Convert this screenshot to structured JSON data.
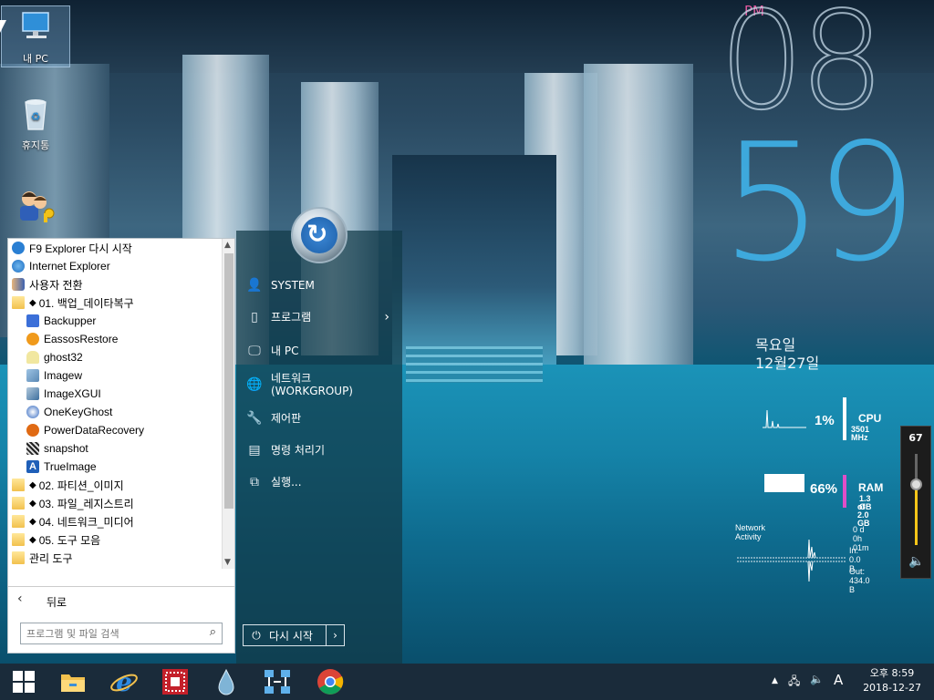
{
  "desktop": {
    "icons": [
      {
        "label": "내 PC",
        "icon": "monitor-icon"
      },
      {
        "label": "휴지통",
        "icon": "recycle-bin-icon"
      },
      {
        "label": "",
        "icon": "users-keys-icon"
      }
    ]
  },
  "clock": {
    "ampm": "PM",
    "hour": "08",
    "minute": "59",
    "weekday": "목요일",
    "date": "12월27일"
  },
  "monitor": {
    "cpu": {
      "label": "CPU",
      "percent": "1%",
      "detail": "3501 MHz",
      "level": 0.01
    },
    "ram": {
      "label": "RAM",
      "percent": "66%",
      "detail1": "1.3 GB",
      "detail2": "of 2.0 GB",
      "level": 0.66
    },
    "network": {
      "title": "Network Activity",
      "uptime": "0 d 0h 01m",
      "in": "In: 0.0 B",
      "out": "Out: 434.0 B"
    },
    "colors": {
      "cpu_bar": "#ffffff",
      "ram_bar": "#e04ec8"
    }
  },
  "volume": {
    "value": "67",
    "level": 0.67
  },
  "start_menu": {
    "programs": [
      {
        "label": "F9 Explorer 다시 시작",
        "icon": "refresh-icon",
        "type": "app",
        "indent": false
      },
      {
        "label": "Internet Explorer",
        "icon": "ie-icon",
        "type": "app",
        "indent": false
      },
      {
        "label": "사용자 전환",
        "icon": "users-icon",
        "type": "app",
        "indent": false
      },
      {
        "label": "01. 백업_데이타복구",
        "icon": "folder-icon",
        "type": "folder",
        "indent": false
      },
      {
        "label": "Backupper",
        "icon": "backupper-icon",
        "type": "app",
        "indent": true
      },
      {
        "label": "EassosRestore",
        "icon": "eassos-icon",
        "type": "app",
        "indent": true
      },
      {
        "label": "ghost32",
        "icon": "ghost-icon",
        "type": "app",
        "indent": true
      },
      {
        "label": "Imagew",
        "icon": "imagew-icon",
        "type": "app",
        "indent": true
      },
      {
        "label": "ImageXGUI",
        "icon": "imagex-icon",
        "type": "app",
        "indent": true
      },
      {
        "label": "OneKeyGhost",
        "icon": "onekey-icon",
        "type": "app",
        "indent": true
      },
      {
        "label": "PowerDataRecovery",
        "icon": "powerdata-icon",
        "type": "app",
        "indent": true
      },
      {
        "label": "snapshot",
        "icon": "snapshot-icon",
        "type": "app",
        "indent": true
      },
      {
        "label": "TrueImage",
        "icon": "trueimage-icon",
        "type": "app",
        "indent": true
      },
      {
        "label": "02. 파티션_이미지",
        "icon": "folder-icon",
        "type": "folder",
        "indent": false
      },
      {
        "label": "03. 파일_레지스트리",
        "icon": "folder-icon",
        "type": "folder",
        "indent": false
      },
      {
        "label": "04. 네트워크_미디어",
        "icon": "folder-icon",
        "type": "folder",
        "indent": false
      },
      {
        "label": "05. 도구 모음",
        "icon": "folder-icon",
        "type": "folder",
        "indent": false
      },
      {
        "label": "관리 도구",
        "icon": "folder-icon",
        "type": "folder",
        "indent": false
      }
    ],
    "back_label": "뒤로",
    "search_placeholder": "프로그램 및 파일 검색",
    "right_items": [
      {
        "label": "SYSTEM",
        "icon": "user-icon"
      },
      {
        "label": "프로그램",
        "icon": "programs-icon"
      },
      {
        "label": "내 PC",
        "icon": "computer-icon"
      },
      {
        "label": "네트워크",
        "sub": "(WORKGROUP)",
        "icon": "network-icon"
      },
      {
        "label": "제어판",
        "icon": "wrench-icon"
      },
      {
        "label": "명령 처리기",
        "icon": "cmd-icon"
      },
      {
        "label": "실행...",
        "icon": "run-icon"
      }
    ],
    "restart_label": "다시 시작"
  },
  "taskbar": {
    "apps": [
      "file-explorer-icon",
      "internet-explorer-icon",
      "app-grid-icon",
      "droplet-icon",
      "network-tool-icon",
      "chrome-icon"
    ],
    "tray_ime": "A",
    "time": "오후 8:59",
    "date": "2018-12-27"
  }
}
